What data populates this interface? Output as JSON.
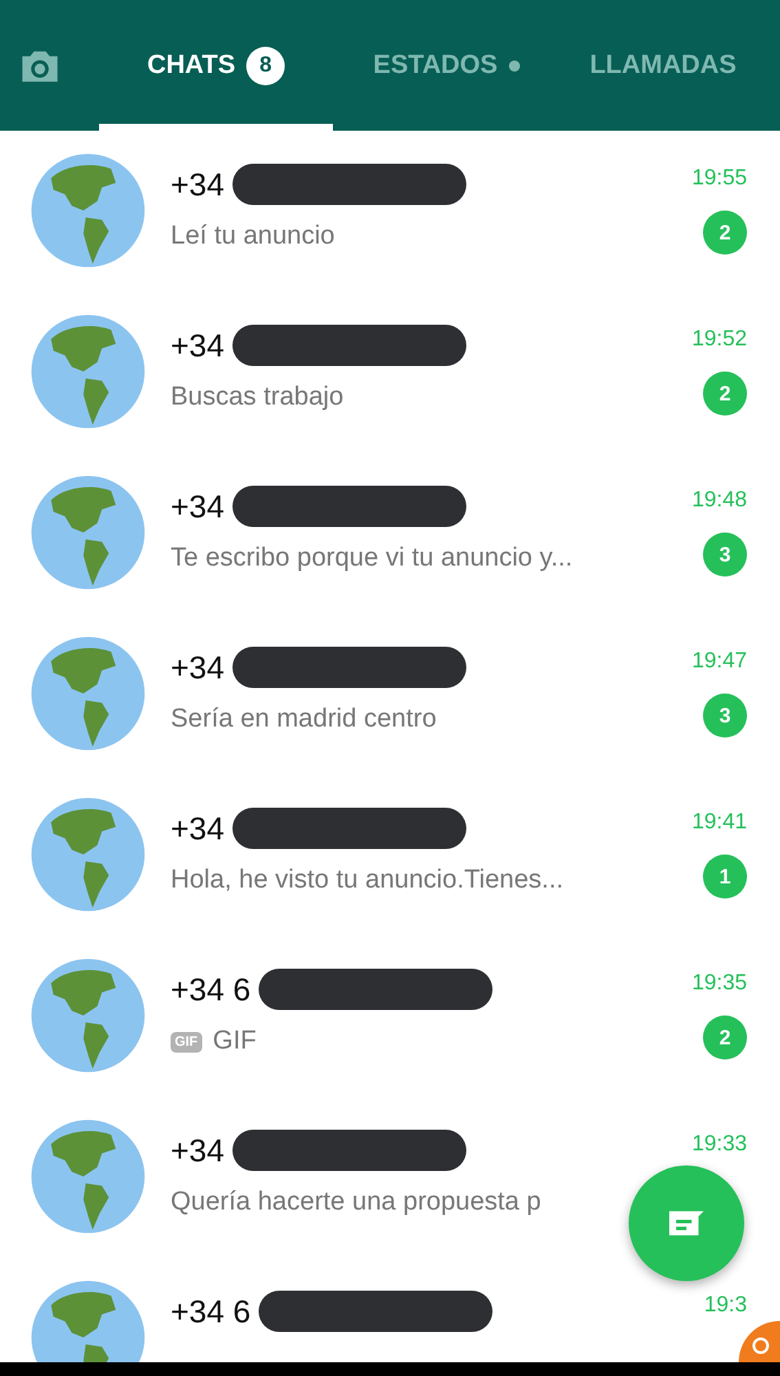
{
  "tabs": [
    {
      "label": "CHATS",
      "selected": true,
      "badge": "8",
      "dot": false
    },
    {
      "label": "ESTADOS",
      "selected": false,
      "dot": true
    },
    {
      "label": "LLAMADAS",
      "selected": false,
      "dot": false
    }
  ],
  "chats": [
    {
      "name": "+34",
      "kind": "text",
      "message": "Leí tu anuncio",
      "time": "19:55",
      "unread": "2"
    },
    {
      "name": "+34",
      "kind": "text",
      "message": "Buscas trabajo",
      "time": "19:52",
      "unread": "2"
    },
    {
      "name": "+34",
      "kind": "text",
      "message": "Te escribo porque vi tu anuncio y...",
      "time": "19:48",
      "unread": "3"
    },
    {
      "name": "+34",
      "kind": "text",
      "message": "Sería en madrid centro",
      "time": "19:47",
      "unread": "3"
    },
    {
      "name": "+34",
      "kind": "text",
      "message": "Hola, he visto tu anuncio.Tienes...",
      "time": "19:41",
      "unread": "1"
    },
    {
      "name": "+34 6",
      "kind": "gif",
      "gif_tag": "GIF",
      "message": "GIF",
      "time": "19:35",
      "unread": "2"
    },
    {
      "name": "+34",
      "kind": "text",
      "message": "Quería hacerte una propuesta p",
      "time": "19:33"
    },
    {
      "name": "+34 6",
      "kind": "text",
      "time": "19:3"
    }
  ]
}
